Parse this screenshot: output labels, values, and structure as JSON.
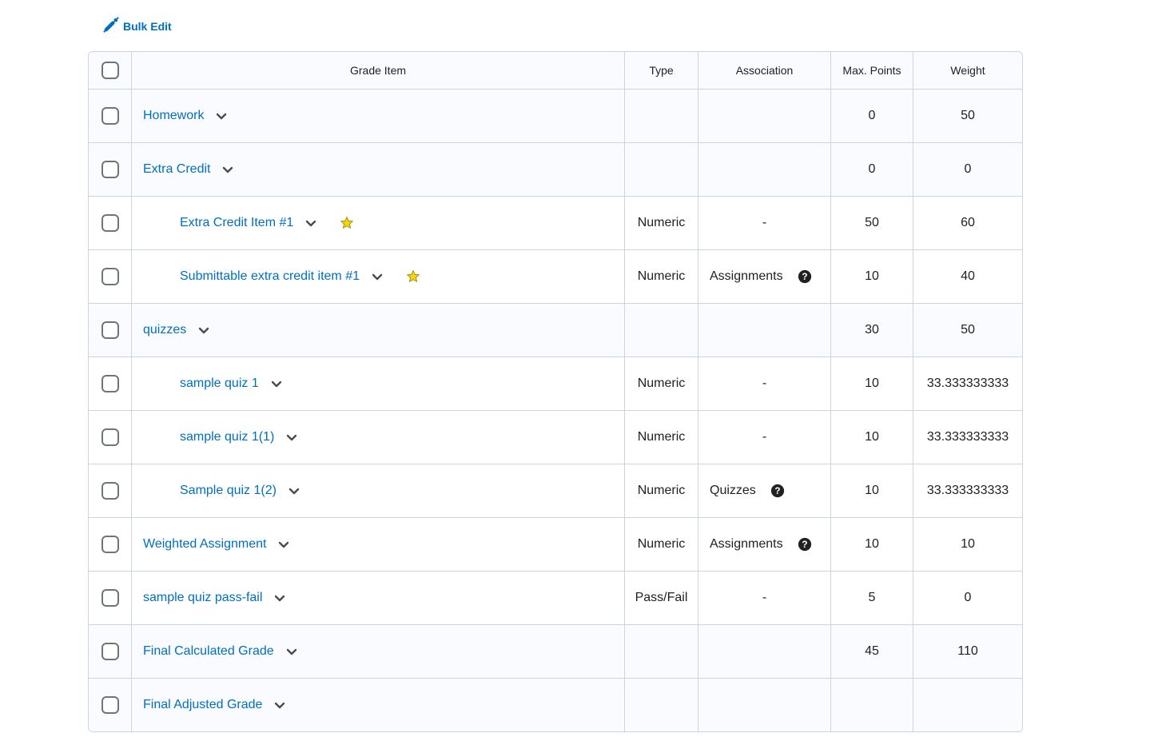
{
  "toolbar": {
    "bulk_edit_label": "Bulk Edit"
  },
  "table": {
    "headers": {
      "grade_item": "Grade Item",
      "type": "Type",
      "association": "Association",
      "max_points": "Max. Points",
      "weight": "Weight"
    },
    "rows": [
      {
        "name": "Homework",
        "type": "",
        "association": "",
        "max": "0",
        "weight": "50"
      },
      {
        "name": "Extra Credit",
        "type": "",
        "association": "",
        "max": "0",
        "weight": "0"
      },
      {
        "name": "Extra Credit Item #1",
        "type": "Numeric",
        "association": "-",
        "max": "50",
        "weight": "60"
      },
      {
        "name": "Submittable extra credit item #1",
        "type": "Numeric",
        "association": "Assignments",
        "max": "10",
        "weight": "40"
      },
      {
        "name": "quizzes",
        "type": "",
        "association": "",
        "max": "30",
        "weight": "50"
      },
      {
        "name": "sample quiz 1",
        "type": "Numeric",
        "association": "-",
        "max": "10",
        "weight": "33.333333333"
      },
      {
        "name": "sample quiz 1(1)",
        "type": "Numeric",
        "association": "-",
        "max": "10",
        "weight": "33.333333333"
      },
      {
        "name": "Sample quiz 1(2)",
        "type": "Numeric",
        "association": "Quizzes",
        "max": "10",
        "weight": "33.333333333"
      },
      {
        "name": "Weighted Assignment",
        "type": "Numeric",
        "association": "Assignments",
        "max": "10",
        "weight": "10"
      },
      {
        "name": "sample quiz pass-fail",
        "type": "Pass/Fail",
        "association": "-",
        "max": "5",
        "weight": "0"
      },
      {
        "name": "Final Calculated Grade",
        "type": "",
        "association": "",
        "max": "45",
        "weight": "110"
      },
      {
        "name": "Final Adjusted Grade",
        "type": "",
        "association": "",
        "max": "",
        "weight": ""
      }
    ]
  },
  "colors": {
    "link": "#006fbf",
    "border": "#cdd5dc",
    "category_bg": "#f9fbff",
    "star": "#f5d20a"
  }
}
